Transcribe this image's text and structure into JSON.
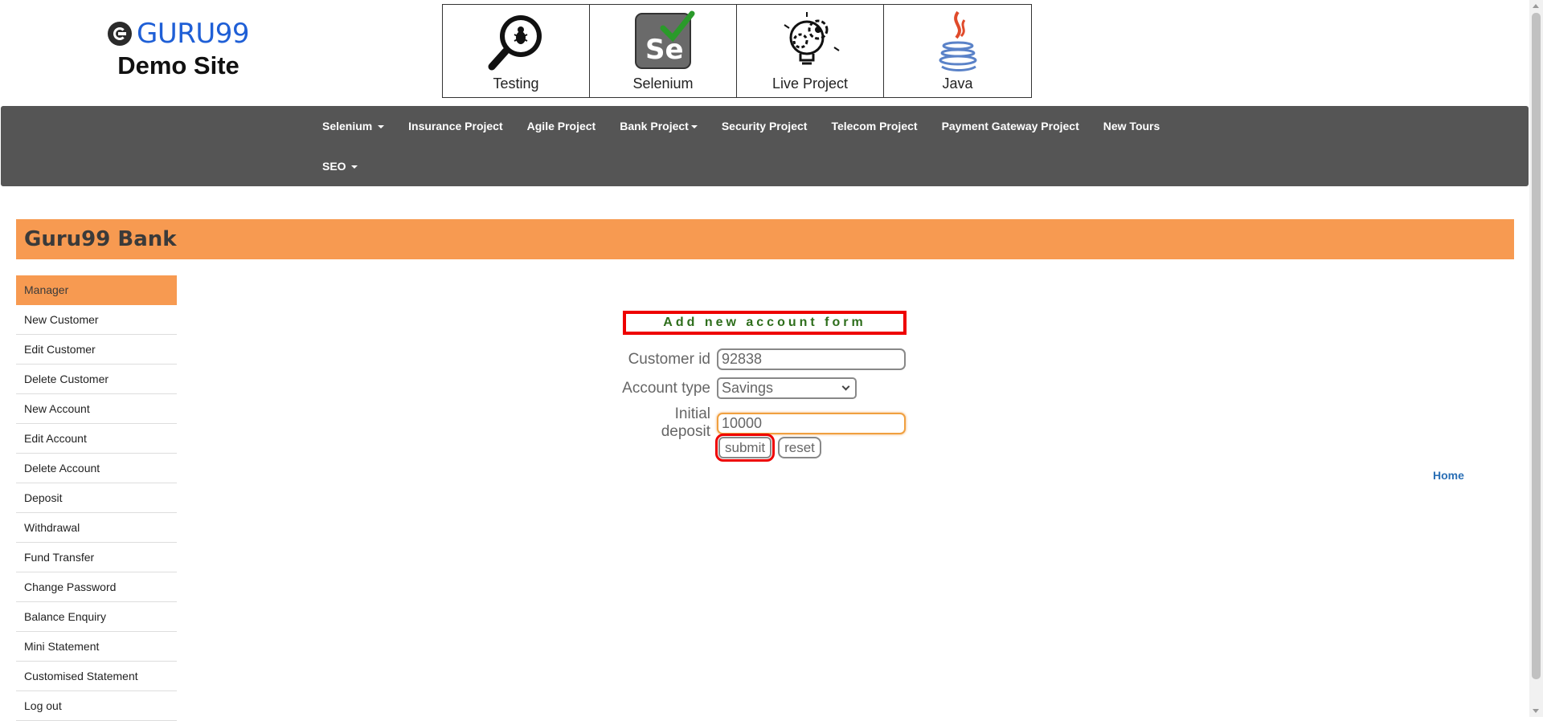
{
  "header": {
    "brand": "GURU99",
    "subtitle": "Demo Site",
    "tiles": [
      {
        "label": "Testing",
        "icon": "magnifier-bug-icon"
      },
      {
        "label": "Selenium",
        "icon": "selenium-icon"
      },
      {
        "label": "Live Project",
        "icon": "gear-lightbulb-icon"
      },
      {
        "label": "Java",
        "icon": "java-icon"
      }
    ]
  },
  "nav": {
    "items": [
      {
        "label": "Selenium",
        "dropdown": true
      },
      {
        "label": "Insurance Project",
        "dropdown": false
      },
      {
        "label": "Agile Project",
        "dropdown": false
      },
      {
        "label": "Bank Project",
        "dropdown": true
      },
      {
        "label": "Security Project",
        "dropdown": false
      },
      {
        "label": "Telecom Project",
        "dropdown": false
      },
      {
        "label": "Payment Gateway Project",
        "dropdown": false
      },
      {
        "label": "New Tours",
        "dropdown": false
      },
      {
        "label": "SEO",
        "dropdown": true
      }
    ]
  },
  "bank": {
    "title": "Guru99 Bank"
  },
  "sidebar": {
    "items": [
      {
        "label": "Manager",
        "active": true
      },
      {
        "label": "New Customer"
      },
      {
        "label": "Edit Customer"
      },
      {
        "label": "Delete Customer"
      },
      {
        "label": "New Account"
      },
      {
        "label": "Edit Account"
      },
      {
        "label": "Delete Account"
      },
      {
        "label": "Deposit"
      },
      {
        "label": "Withdrawal"
      },
      {
        "label": "Fund Transfer"
      },
      {
        "label": "Change Password"
      },
      {
        "label": "Balance Enquiry"
      },
      {
        "label": "Mini Statement"
      },
      {
        "label": "Customised Statement"
      },
      {
        "label": "Log out"
      }
    ]
  },
  "form": {
    "title": "Add new account form",
    "customer_id_label": "Customer id",
    "customer_id_value": "92838",
    "account_type_label": "Account type",
    "account_type_value": "Savings",
    "initial_deposit_label": "Initial deposit",
    "initial_deposit_value": "10000",
    "submit_label": "submit",
    "reset_label": "reset"
  },
  "home_link": "Home",
  "colors": {
    "accent_orange": "#f79a51",
    "nav_bg": "#555555",
    "brand_blue": "#1f5fd6",
    "highlight_red": "#e00000",
    "form_title_green": "#2e6e1c"
  }
}
